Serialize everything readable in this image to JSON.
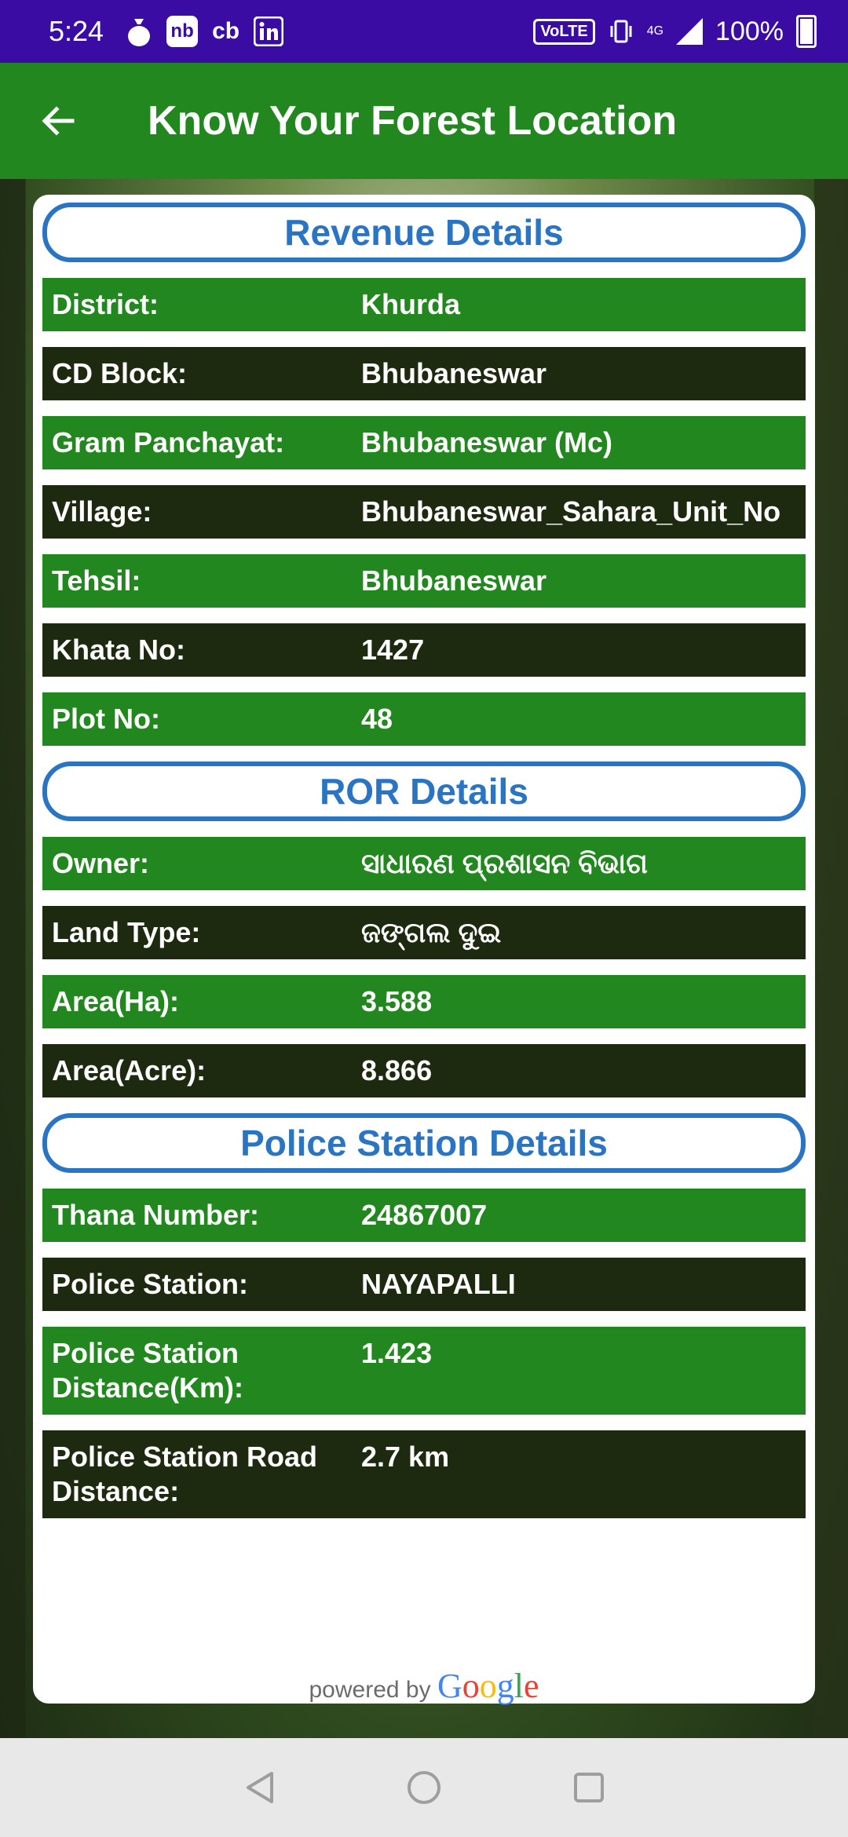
{
  "status_bar": {
    "time": "5:24",
    "left_icons": [
      "money-bag-icon",
      "nb-app-icon",
      "cb-app-icon",
      "linkedin-icon"
    ],
    "nb_label": "nb",
    "cb_label": "cb",
    "volte": "VoLTE",
    "network": "4G",
    "battery": "100%"
  },
  "app_bar": {
    "title": "Know Your Forest Location"
  },
  "sections": {
    "revenue": {
      "title": "Revenue Details",
      "rows": [
        {
          "label": "District:",
          "value": "Khurda"
        },
        {
          "label": "CD Block:",
          "value": "Bhubaneswar"
        },
        {
          "label": "Gram Panchayat:",
          "value": "Bhubaneswar (Mc)"
        },
        {
          "label": "Village:",
          "value": "Bhubaneswar_Sahara_Unit_No"
        },
        {
          "label": "Tehsil:",
          "value": "Bhubaneswar"
        },
        {
          "label": "Khata No:",
          "value": "1427"
        },
        {
          "label": "Plot No:",
          "value": "48"
        }
      ]
    },
    "ror": {
      "title": "ROR Details",
      "rows": [
        {
          "label": "Owner:",
          "value": "ସାଧାରଣ ପ୍ରଶାସନ ବିଭାଗ"
        },
        {
          "label": "Land Type:",
          "value": "ଜଙ୍ଗଲ ଦୁଇ"
        },
        {
          "label": "Area(Ha):",
          "value": "3.588"
        },
        {
          "label": "Area(Acre):",
          "value": "8.866"
        }
      ]
    },
    "police": {
      "title": "Police Station Details",
      "rows": [
        {
          "label": "Thana Number:",
          "value": "24867007"
        },
        {
          "label": "Police Station:",
          "value": "NAYAPALLI"
        },
        {
          "label": "Police Station Distance(Km):",
          "value": "1.423"
        },
        {
          "label": "Police Station Road Distance:",
          "value": "2.7 km"
        }
      ]
    }
  },
  "footer": {
    "powered_by": "powered by",
    "google": "Google"
  },
  "colors": {
    "status_bar": "#3a0ca3",
    "app_bar": "#22871f",
    "row_green": "#22871f",
    "row_dark": "#1e2a0f",
    "section_blue": "#2a74c4"
  }
}
